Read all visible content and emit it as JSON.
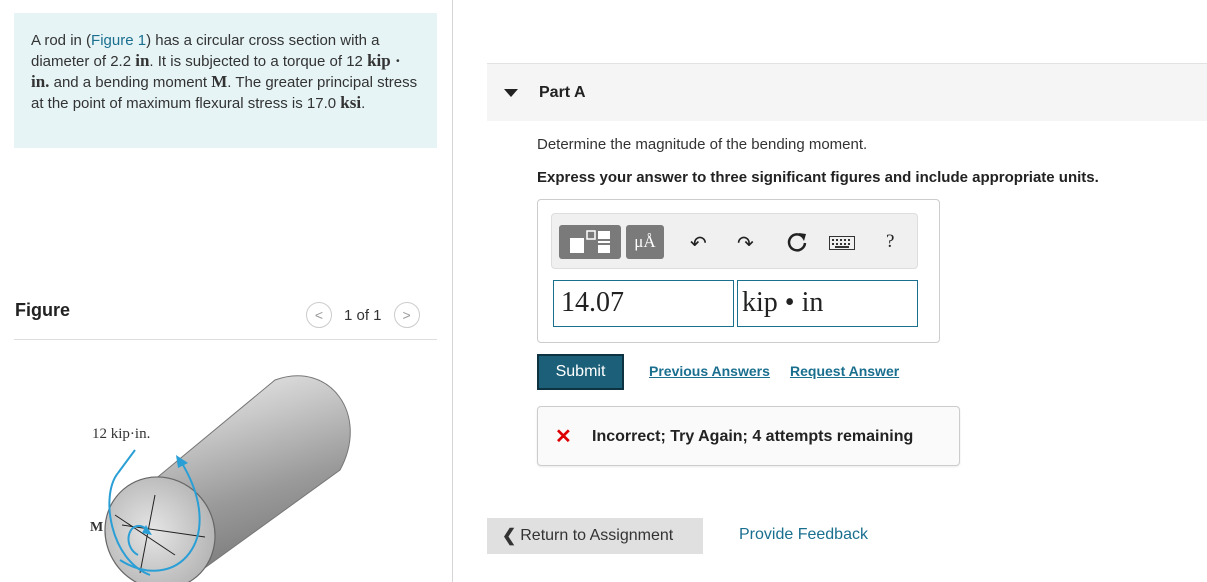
{
  "problem": {
    "intro_a": "A rod in (",
    "figure_link": "Figure 1",
    "intro_b": ") has a circular cross section with a diameter of 2.2 ",
    "unit_in": "in",
    "intro_c": ". It is subjected to a torque of 12 ",
    "unit_kipin": "kip · in.",
    "intro_d": " and a bending moment ",
    "sym_M": "M",
    "intro_e": ". The greater principal stress at the point of maximum flexural stress is 17.0 ",
    "unit_ksi": "ksi",
    "intro_f": "."
  },
  "figure": {
    "label": "Figure",
    "pager": "1 of 1",
    "torque_label": "12 kip·in.",
    "moment_label": "M"
  },
  "part": {
    "title": "Part A",
    "question": "Determine the magnitude of the bending moment.",
    "instruction": "Express your answer to three significant figures and include appropriate units."
  },
  "toolbar": {
    "units_label": "μÅ",
    "help_label": "?"
  },
  "answer": {
    "value": "14.07",
    "units": "kip • in"
  },
  "actions": {
    "submit": "Submit",
    "previous_answers": "Previous Answers",
    "request_answer": "Request Answer"
  },
  "feedback": {
    "icon": "✕",
    "message": "Incorrect; Try Again; 4 attempts remaining"
  },
  "footer": {
    "return": "Return to Assignment",
    "provide_feedback": "Provide Feedback"
  }
}
